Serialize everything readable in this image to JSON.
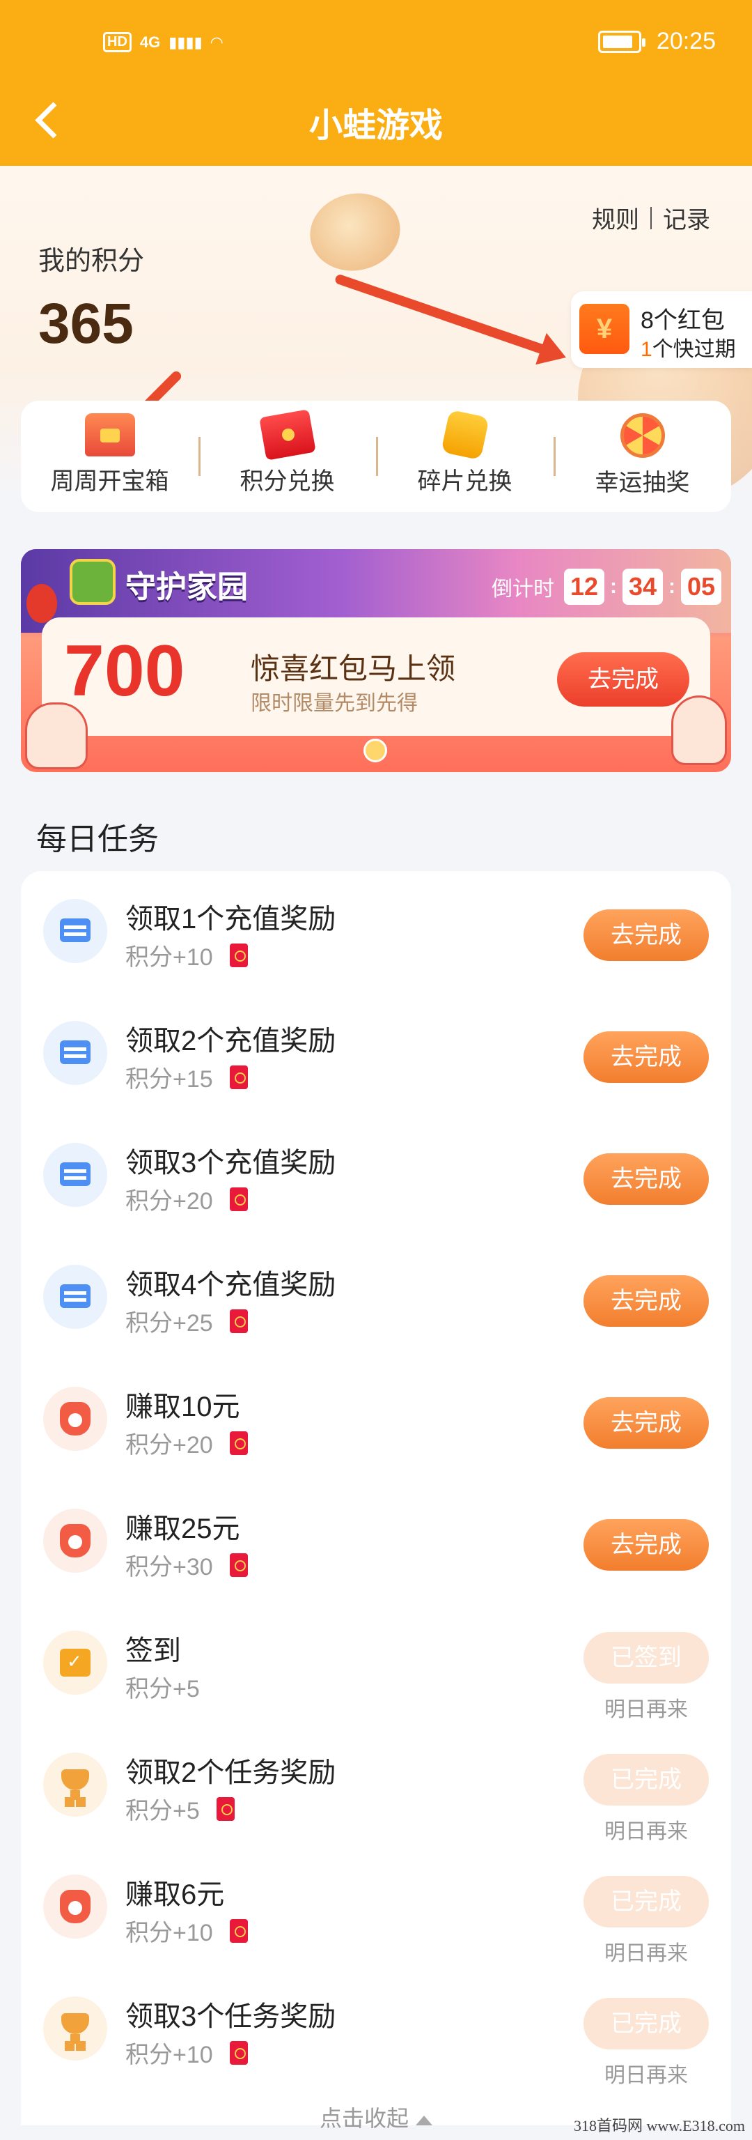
{
  "status_bar": {
    "hd": "HD",
    "network": "4G",
    "time": "20:25"
  },
  "header": {
    "title": "小蛙游戏"
  },
  "points": {
    "label": "我的积分",
    "value": "365",
    "rules": "规则",
    "records": "记录",
    "red_packets": "8个红包",
    "expiring_count": "1",
    "expiring_text": "个快过期"
  },
  "quick_actions": [
    {
      "label": "周周开宝箱",
      "icon": "treasure-chest-icon"
    },
    {
      "label": "积分兑换",
      "icon": "red-envelope-icon"
    },
    {
      "label": "碎片兑换",
      "icon": "puzzle-piece-icon"
    },
    {
      "label": "幸运抽奖",
      "icon": "lucky-wheel-icon"
    }
  ],
  "banner": {
    "title": "守护家园",
    "countdown_label": "倒计时",
    "hours": "12",
    "minutes": "34",
    "seconds": "05",
    "amount": "700",
    "headline": "惊喜红包马上领",
    "subline": "限时限量先到先得",
    "button": "去完成"
  },
  "daily_tasks": {
    "title": "每日任务",
    "items": [
      {
        "name": "领取1个充值奖励",
        "points": "积分+10",
        "button": "去完成",
        "icon": "card",
        "done": false
      },
      {
        "name": "领取2个充值奖励",
        "points": "积分+15",
        "button": "去完成",
        "icon": "card",
        "done": false
      },
      {
        "name": "领取3个充值奖励",
        "points": "积分+20",
        "button": "去完成",
        "icon": "card",
        "done": false
      },
      {
        "name": "领取4个充值奖励",
        "points": "积分+25",
        "button": "去完成",
        "icon": "card",
        "done": false
      },
      {
        "name": "赚取10元",
        "points": "积分+20",
        "button": "去完成",
        "icon": "money-bag",
        "done": false
      },
      {
        "name": "赚取25元",
        "points": "积分+30",
        "button": "去完成",
        "icon": "money-bag",
        "done": false
      },
      {
        "name": "签到",
        "points": "积分+5",
        "button": "已签到",
        "note": "明日再来",
        "icon": "calendar-check",
        "done": true
      },
      {
        "name": "领取2个任务奖励",
        "points": "积分+5",
        "button": "已完成",
        "note": "明日再来",
        "icon": "trophy",
        "done": true
      },
      {
        "name": "赚取6元",
        "points": "积分+10",
        "button": "已完成",
        "note": "明日再来",
        "icon": "money-bag",
        "done": true
      },
      {
        "name": "领取3个任务奖励",
        "points": "积分+10",
        "button": "已完成",
        "note": "明日再来",
        "icon": "trophy",
        "done": true
      }
    ],
    "collapse": "点击收起"
  },
  "watermark": "318首码网 www.E318.com",
  "colors": {
    "brand": "#fbae13",
    "accent": "#f27e2e",
    "red": "#e8342a"
  }
}
